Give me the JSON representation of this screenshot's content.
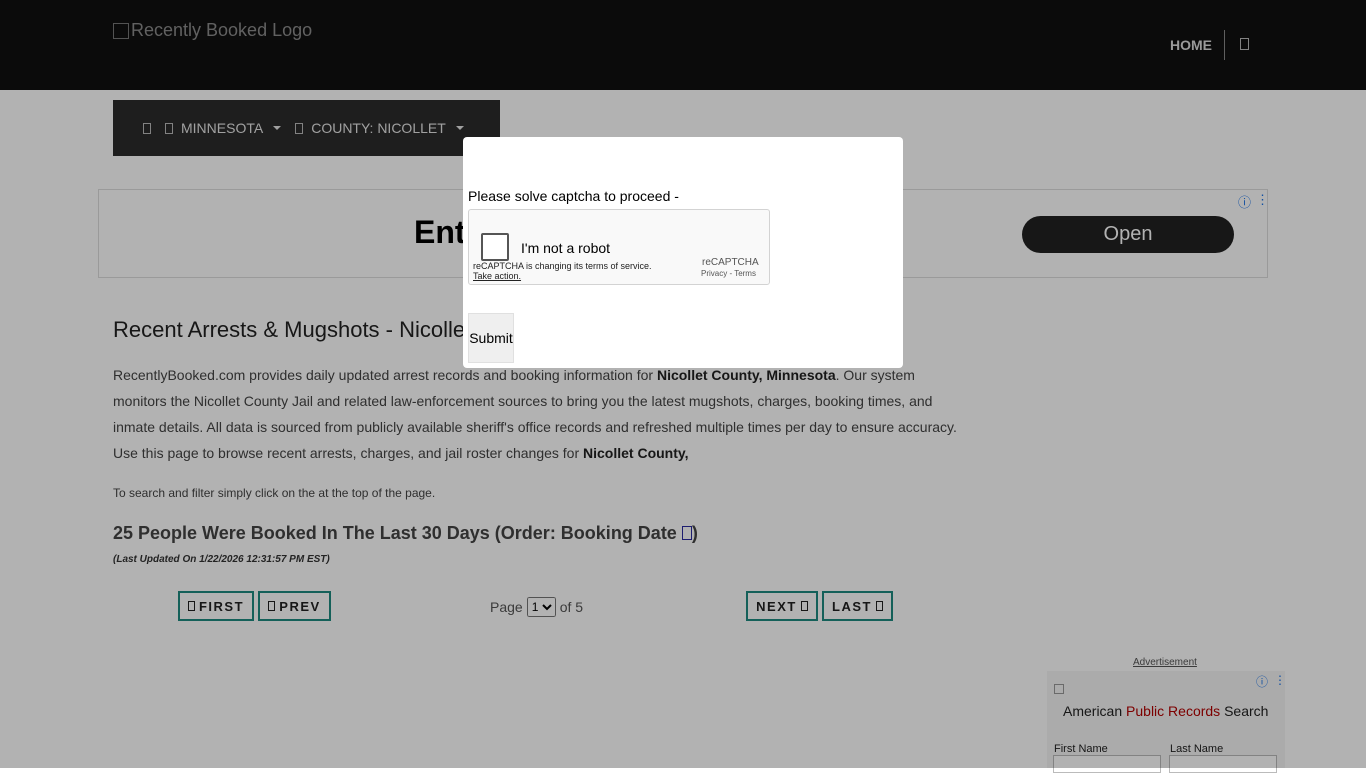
{
  "header": {
    "logo_alt": "Recently Booked Logo",
    "nav_home": "HOME"
  },
  "breadcrumb": {
    "home_icon": "home-icon",
    "state": "MINNESOTA",
    "county": "COUNTY: NICOLLET"
  },
  "ad_banner": {
    "text": "Ent",
    "button": "Open",
    "info": "ⓘ",
    "dots": "⋮"
  },
  "main": {
    "title": "Recent Arrests & Mugshots - Nicollet",
    "desc_part1": "RecentlyBooked.com provides daily updated arrest records and booking information for ",
    "desc_bold1": "Nicollet County, Minnesota",
    "desc_part2": ". Our system monitors the Nicollet County Jail and related law-enforcement sources to bring you the latest mugshots, charges, booking times, and inmate details. All data is sourced from publicly available sheriff's office records and refreshed multiple times per day to ensure accuracy. Use this page to browse recent arrests, charges, and jail roster changes for ",
    "desc_bold2": "Nicollet County,",
    "hint": "To search and filter simply click on the  at the top of the page.",
    "booked": "25 People Were Booked In The Last 30 Days (Order: Booking Date ",
    "booked_close": ")",
    "updated": "(Last Updated On 1/22/2026 12:31:57 PM EST)"
  },
  "pagination": {
    "first": "FIRST",
    "prev": "PREV",
    "next": "NEXT",
    "last": "LAST",
    "page_label": "Page",
    "current_page": "1",
    "of_label": "of 5"
  },
  "side_ad": {
    "label": "Advertisement",
    "title_pre": "American ",
    "title_red": "Public Records",
    "title_post": " Search",
    "first_name": "First Name",
    "last_name": "Last Name"
  },
  "captcha_modal": {
    "prompt": "Please solve captcha to proceed -",
    "checkbox_label": "I'm not a robot",
    "notice": "reCAPTCHA is changing its terms of service.",
    "take_action": "Take action.",
    "brand": "reCAPTCHA",
    "privacy_terms": "Privacy - Terms",
    "submit": "Submit"
  }
}
